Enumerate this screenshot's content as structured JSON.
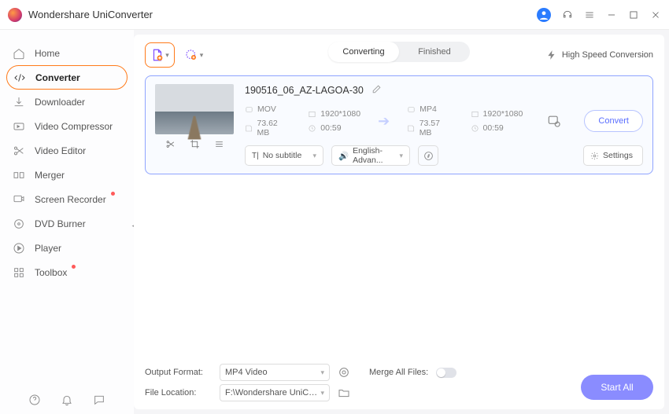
{
  "app_title": "Wondershare UniConverter",
  "sidebar": {
    "items": [
      {
        "label": "Home"
      },
      {
        "label": "Converter"
      },
      {
        "label": "Downloader"
      },
      {
        "label": "Video Compressor"
      },
      {
        "label": "Video Editor"
      },
      {
        "label": "Merger"
      },
      {
        "label": "Screen Recorder"
      },
      {
        "label": "DVD Burner"
      },
      {
        "label": "Player"
      },
      {
        "label": "Toolbox"
      }
    ]
  },
  "tabs": {
    "converting": "Converting",
    "finished": "Finished"
  },
  "highspeed": "High Speed Conversion",
  "file": {
    "name": "190516_06_AZ-LAGOA-30",
    "src": {
      "fmt": "MOV",
      "res": "1920*1080",
      "size": "73.62 MB",
      "dur": "00:59"
    },
    "dst": {
      "fmt": "MP4",
      "res": "1920*1080",
      "size": "73.57 MB",
      "dur": "00:59"
    }
  },
  "subtitle": "No subtitle",
  "audio": "English-Advan...",
  "settings": "Settings",
  "convert": "Convert",
  "footer": {
    "out_fmt_label": "Output Format:",
    "out_fmt_value": "MP4 Video",
    "loc_label": "File Location:",
    "loc_value": "F:\\Wondershare UniConverter",
    "merge_label": "Merge All Files:"
  },
  "startall": "Start All"
}
